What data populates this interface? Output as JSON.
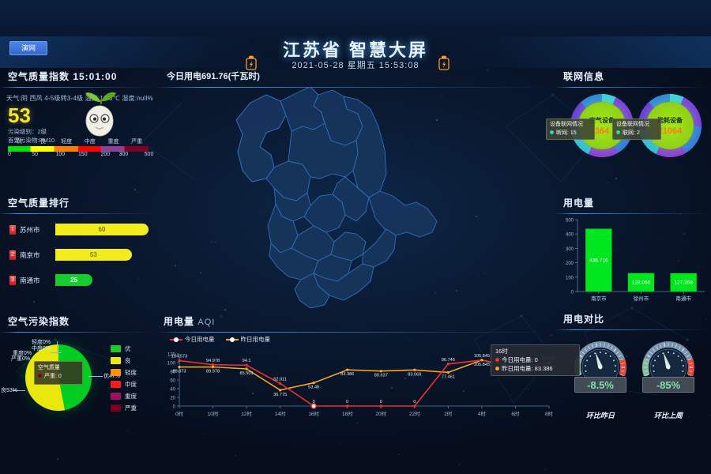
{
  "header": {
    "button_label": "演网",
    "title": "江苏省 智慧大屏",
    "datetime": "2021-05-28 星期五 15:53:08",
    "alarm_icon_left": "alarm-icon",
    "alarm_icon_right": "alarm-icon"
  },
  "aqi": {
    "panel_title": "空气质量指数 15:01:00",
    "meta": "天气:阴 西风 4-5级转3-4级 温度:19.3℃ 湿度:null%",
    "value": "53",
    "level_text": "污染级别：2级",
    "primary_text": "首要污染物:PM10",
    "scale_labels": [
      "优",
      "良",
      "轻度",
      "中度",
      "重度",
      "严重"
    ],
    "scale_ticks": [
      "0",
      "50",
      "100",
      "150",
      "200",
      "300",
      "500"
    ],
    "scale_colors": [
      "#00e400",
      "#ffff00",
      "#ff7e00",
      "#ff0000",
      "#8f3f97",
      "#7e0023"
    ]
  },
  "ranking": {
    "panel_title": "空气质量排行",
    "rows": [
      {
        "rank": "1",
        "city": "苏州市",
        "value": "60",
        "color": "#f2ec1c",
        "pct": 100
      },
      {
        "rank": "2",
        "city": "南京市",
        "value": "53",
        "color": "#f2ec1c",
        "pct": 82
      },
      {
        "rank": "3",
        "city": "南通市",
        "value": "25",
        "color": "#16cc2e",
        "pct": 40
      }
    ]
  },
  "pollution": {
    "panel_title": "空气污染指数",
    "tooltip_title": "空气质量",
    "tooltip_value": "严重: 0",
    "labels": [
      {
        "text": "优47%"
      },
      {
        "text": "良53%"
      },
      {
        "text": "轻度0%"
      },
      {
        "text": "中度0%"
      },
      {
        "text": "重度0%"
      },
      {
        "text": "严重0%"
      }
    ],
    "legend": [
      {
        "name": "优",
        "color": "#16cc2e"
      },
      {
        "name": "良",
        "color": "#e8e80d"
      },
      {
        "name": "轻度",
        "color": "#ff9000"
      },
      {
        "name": "中度",
        "color": "#ff1a1a"
      },
      {
        "name": "重度",
        "color": "#a01060"
      },
      {
        "name": "严重",
        "color": "#7a0020"
      }
    ],
    "chart_data": {
      "type": "pie",
      "title": "空气污染指数",
      "categories": [
        "优",
        "良",
        "轻度",
        "中度",
        "重度",
        "严重"
      ],
      "values": [
        47,
        53,
        0,
        0,
        0,
        0
      ],
      "unit": "%",
      "legend_position": "right"
    }
  },
  "center": {
    "kpi_text": "今日用电691.76(千瓦时)",
    "map_name": "jiangsu-province-map"
  },
  "line_chart": {
    "panel_title": "用电量",
    "panel_subtitle": "AQI",
    "legend": [
      {
        "name": "今日用电量",
        "color": "#f03030"
      },
      {
        "name": "昨日用电量",
        "color": "#f5a623"
      }
    ],
    "tooltip": {
      "time": "16时",
      "series1_label": "今日用电量: 0",
      "series1_color": "#f03030",
      "series2_label": "昨日用电量: 83.386",
      "series2_color": "#f5a623"
    },
    "chart_data": {
      "type": "line",
      "title": "用电量 AQI",
      "xlabel": "",
      "ylabel": "",
      "ylim": [
        0,
        120
      ],
      "yticks": [
        0,
        20,
        40,
        60,
        80,
        100,
        120
      ],
      "grid": false,
      "categories": [
        "0时",
        "10时",
        "12时",
        "14时",
        "16时",
        "18时",
        "20时",
        "22时",
        "2时",
        "4时",
        "6时",
        "8时"
      ],
      "x_axis_ticks": [
        "0时",
        "10时",
        "12时",
        "14时",
        "16时",
        "18时",
        "20时",
        "22时",
        "2时",
        "4时",
        "6时",
        "8时"
      ],
      "series": [
        {
          "name": "今日用电量",
          "color": "#f03030",
          "values": [
            104.573,
            94.978,
            94.1,
            52.011,
            0,
            0,
            0,
            0,
            96.746,
            105.845,
            89.468,
            99.683
          ],
          "labels": [
            "104.573",
            "94.978",
            "94.1",
            "52.011",
            "0",
            "0",
            "0",
            "0",
            "96.746",
            "105.845",
            "89.468",
            "99.683"
          ]
        },
        {
          "name": "昨日用电量",
          "color": "#f5a623",
          "values": [
            89.873,
            89.978,
            85.501,
            36.775,
            53.48,
            83.386,
            80.637,
            83.069,
            77.461,
            105.845,
            89.468,
            99.683
          ],
          "labels": [
            "89.873",
            "89.978",
            "85.501",
            "36.775",
            "53.48",
            "83.386",
            "80.637",
            "83.069",
            "77.461",
            "105.845",
            "89.468",
            "99.683"
          ]
        }
      ]
    }
  },
  "network": {
    "panel_title": "联网信息",
    "gauges": [
      {
        "name": "空气设备",
        "value": "364",
        "tip_title": "设备联网情况",
        "tip_value": "断网: 15"
      },
      {
        "name": "能耗设备",
        "value": "21064",
        "tip_title": "设备联网情况",
        "tip_value": "联网: 2"
      }
    ]
  },
  "power_bar": {
    "panel_title": "用电量",
    "chart_data": {
      "type": "bar",
      "title": "用电量",
      "categories": [
        "南京市",
        "徐州市",
        "南通市"
      ],
      "values": [
        436.716,
        128.065,
        127.359
      ],
      "labels": [
        "436.716",
        "128.065",
        "127.359"
      ],
      "xlabel": "",
      "ylabel": "",
      "ylim": [
        0,
        500
      ],
      "yticks": [
        0,
        100,
        200,
        300,
        400,
        500
      ],
      "bar_color": "#00e61e",
      "grid": false
    }
  },
  "compare": {
    "panel_title": "用电对比",
    "gauges": [
      {
        "value": "-8.5%",
        "caption": "环比昨日",
        "needle_deg": -18
      },
      {
        "value": "-85%",
        "caption": "环比上周",
        "needle_deg": -18
      }
    ]
  }
}
